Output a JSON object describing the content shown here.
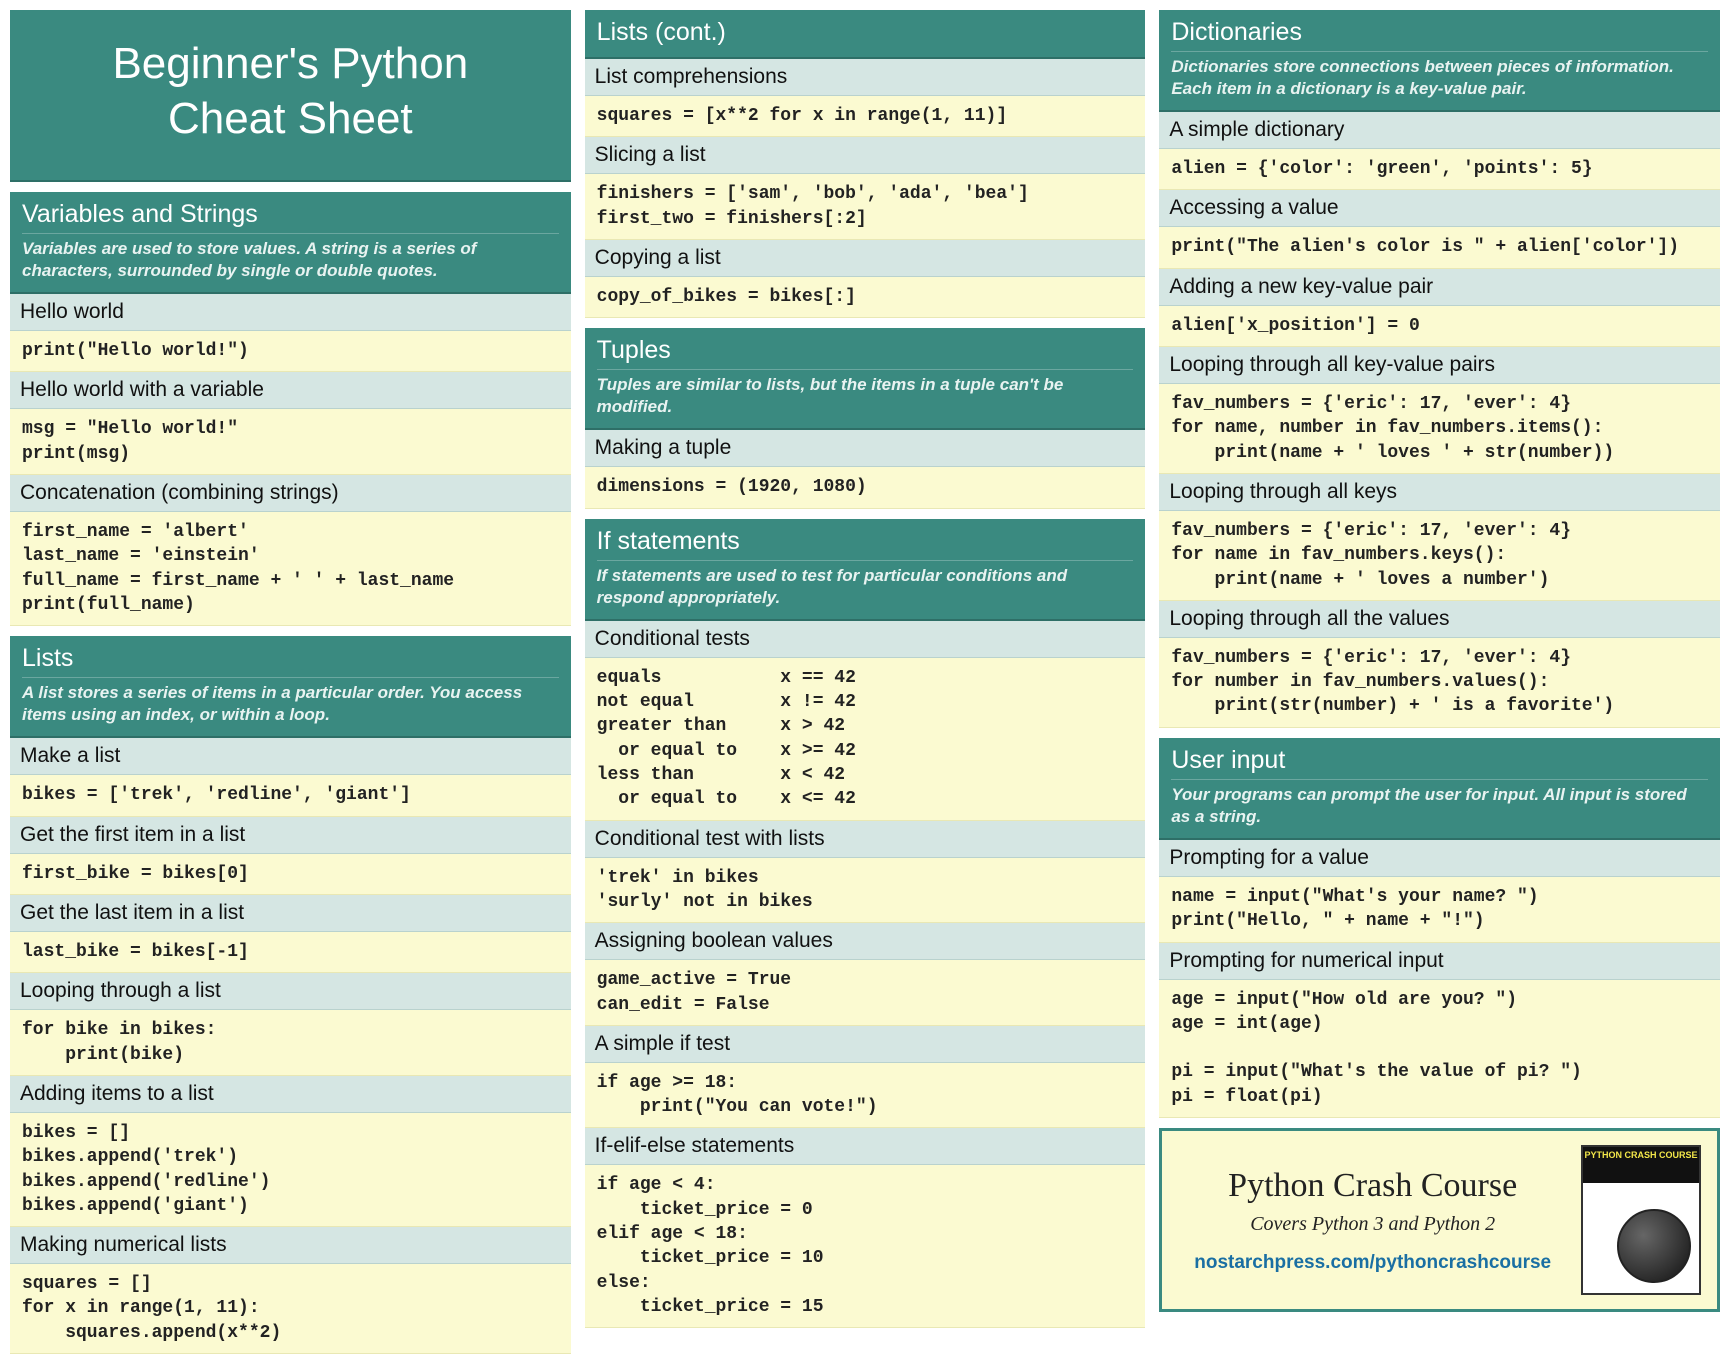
{
  "title_line1": "Beginner's Python",
  "title_line2": "Cheat Sheet",
  "col1": {
    "vars": {
      "title": "Variables and Strings",
      "desc": "Variables are used to store values. A string is a series of characters, surrounded by single or double quotes.",
      "items": [
        {
          "sub": "Hello world",
          "code": "print(\"Hello world!\")"
        },
        {
          "sub": "Hello world with a variable",
          "code": "msg = \"Hello world!\"\nprint(msg)"
        },
        {
          "sub": "Concatenation (combining strings)",
          "code": "first_name = 'albert'\nlast_name = 'einstein'\nfull_name = first_name + ' ' + last_name\nprint(full_name)"
        }
      ]
    },
    "lists": {
      "title": "Lists",
      "desc": "A list stores a series of items in a particular order. You access items using an index, or within a loop.",
      "items": [
        {
          "sub": "Make a list",
          "code": "bikes = ['trek', 'redline', 'giant']"
        },
        {
          "sub": "Get the first item in a list",
          "code": "first_bike = bikes[0]"
        },
        {
          "sub": "Get the last item in a list",
          "code": "last_bike = bikes[-1]"
        },
        {
          "sub": "Looping through a list",
          "code": "for bike in bikes:\n    print(bike)"
        },
        {
          "sub": "Adding items to a list",
          "code": "bikes = []\nbikes.append('trek')\nbikes.append('redline')\nbikes.append('giant')"
        },
        {
          "sub": "Making numerical lists",
          "code": "squares = []\nfor x in range(1, 11):\n    squares.append(x**2)"
        }
      ]
    }
  },
  "col2": {
    "lists_cont": {
      "title": "Lists (cont.)",
      "items": [
        {
          "sub": "List comprehensions",
          "code": "squares = [x**2 for x in range(1, 11)]"
        },
        {
          "sub": "Slicing a list",
          "code": "finishers = ['sam', 'bob', 'ada', 'bea']\nfirst_two = finishers[:2]"
        },
        {
          "sub": "Copying a list",
          "code": "copy_of_bikes = bikes[:]"
        }
      ]
    },
    "tuples": {
      "title": "Tuples",
      "desc": "Tuples are similar to lists, but the items in a tuple can't be modified.",
      "items": [
        {
          "sub": "Making a tuple",
          "code": "dimensions = (1920, 1080)"
        }
      ]
    },
    "ifs": {
      "title": "If statements",
      "desc": "If statements are used to test for particular conditions and respond appropriately.",
      "items": [
        {
          "sub": "Conditional tests",
          "code": "equals           x == 42\nnot equal        x != 42\ngreater than     x > 42\n  or equal to    x >= 42\nless than        x < 42\n  or equal to    x <= 42"
        },
        {
          "sub": "Conditional test with lists",
          "code": "'trek' in bikes\n'surly' not in bikes"
        },
        {
          "sub": "Assigning boolean values",
          "code": "game_active = True\ncan_edit = False"
        },
        {
          "sub": "A simple if test",
          "code": "if age >= 18:\n    print(\"You can vote!\")"
        },
        {
          "sub": "If-elif-else statements",
          "code": "if age < 4:\n    ticket_price = 0\nelif age < 18:\n    ticket_price = 10\nelse:\n    ticket_price = 15"
        }
      ]
    }
  },
  "col3": {
    "dicts": {
      "title": "Dictionaries",
      "desc": "Dictionaries store connections between pieces of information. Each item in a dictionary is a key-value pair.",
      "items": [
        {
          "sub": "A simple dictionary",
          "code": "alien = {'color': 'green', 'points': 5}"
        },
        {
          "sub": "Accessing a value",
          "code": "print(\"The alien's color is \" + alien['color'])"
        },
        {
          "sub": "Adding a new key-value pair",
          "code": "alien['x_position'] = 0"
        },
        {
          "sub": "Looping through all key-value pairs",
          "code": "fav_numbers = {'eric': 17, 'ever': 4}\nfor name, number in fav_numbers.items():\n    print(name + ' loves ' + str(number))"
        },
        {
          "sub": "Looping through all keys",
          "code": "fav_numbers = {'eric': 17, 'ever': 4}\nfor name in fav_numbers.keys():\n    print(name + ' loves a number')"
        },
        {
          "sub": "Looping through all the values",
          "code": "fav_numbers = {'eric': 17, 'ever': 4}\nfor number in fav_numbers.values():\n    print(str(number) + ' is a favorite')"
        }
      ]
    },
    "input": {
      "title": "User input",
      "desc": "Your programs can prompt the user for input. All input is stored as a string.",
      "items": [
        {
          "sub": "Prompting for a value",
          "code": "name = input(\"What's your name? \")\nprint(\"Hello, \" + name + \"!\")"
        },
        {
          "sub": "Prompting for numerical input",
          "code": "age = input(\"How old are you? \")\nage = int(age)\n\npi = input(\"What's the value of pi? \")\npi = float(pi)"
        }
      ]
    }
  },
  "promo": {
    "title": "Python Crash Course",
    "subtitle": "Covers Python 3 and Python 2",
    "link": "nostarchpress.com/pythoncrashcourse",
    "book_label": "PYTHON\nCRASH COURSE"
  }
}
